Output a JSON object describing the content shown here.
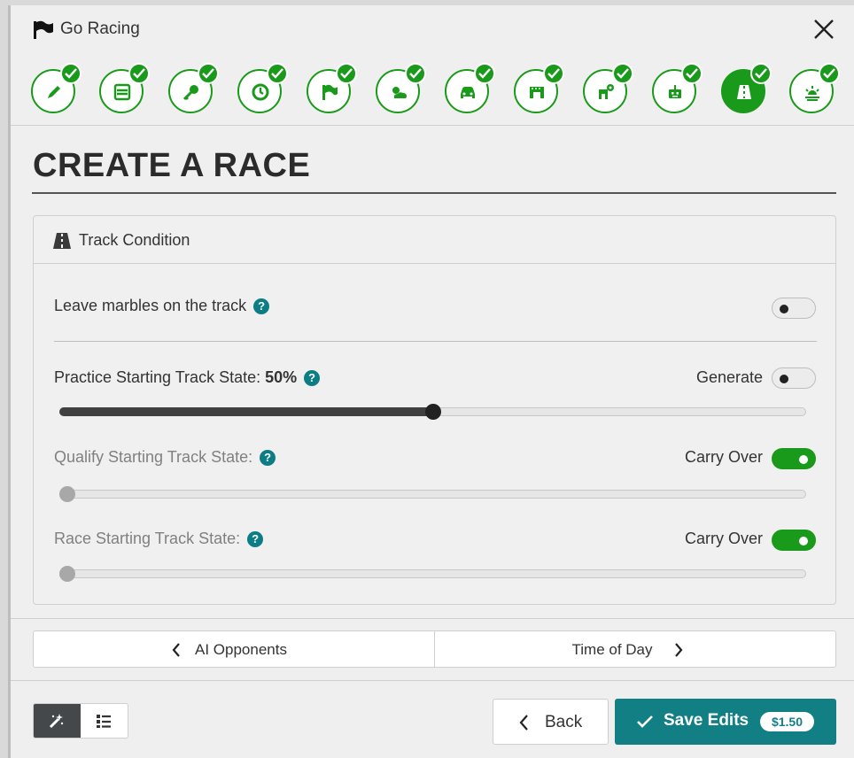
{
  "window": {
    "title": "Go Racing",
    "icons": {
      "title": "flag-icon",
      "close": "close-icon"
    }
  },
  "stepper": {
    "steps": [
      {
        "icon": "pencil-icon",
        "completed": true
      },
      {
        "icon": "list-icon",
        "completed": true
      },
      {
        "icon": "key-icon",
        "completed": true
      },
      {
        "icon": "clock-icon",
        "completed": true
      },
      {
        "icon": "flag-icon",
        "completed": true
      },
      {
        "icon": "weather-icon",
        "completed": true
      },
      {
        "icon": "car-icon",
        "completed": true
      },
      {
        "icon": "garage-icon",
        "completed": true
      },
      {
        "icon": "car-setup-icon",
        "completed": true
      },
      {
        "icon": "robot-icon",
        "completed": true
      },
      {
        "icon": "road-icon",
        "completed": true,
        "active": true
      },
      {
        "icon": "sunrise-icon",
        "completed": true
      }
    ],
    "accent": "#1a9a1a"
  },
  "page": {
    "title": "CREATE A RACE"
  },
  "panel": {
    "header": {
      "icon": "road-icon",
      "label": "Track Condition"
    },
    "marbles": {
      "label": "Leave marbles on the track",
      "toggle_on": false
    },
    "practice": {
      "label": "Practice Starting Track State:",
      "value_text": "50%",
      "value": 50,
      "toggle_label": "Generate",
      "toggle_on": false
    },
    "qualify": {
      "label": "Qualify Starting Track State:",
      "value": 0,
      "toggle_label": "Carry Over",
      "toggle_on": true
    },
    "race": {
      "label": "Race Starting Track State:",
      "value": 0,
      "toggle_label": "Carry Over",
      "toggle_on": true
    },
    "help_glyph": "?"
  },
  "nav": {
    "prev_label": "AI Opponents",
    "next_label": "Time of Day"
  },
  "footer": {
    "view_icons": [
      "wizard-icon",
      "list-view-icon"
    ],
    "back_label": "Back",
    "save_label": "Save Edits",
    "price": "$1.50",
    "save_color": "#127f84"
  }
}
